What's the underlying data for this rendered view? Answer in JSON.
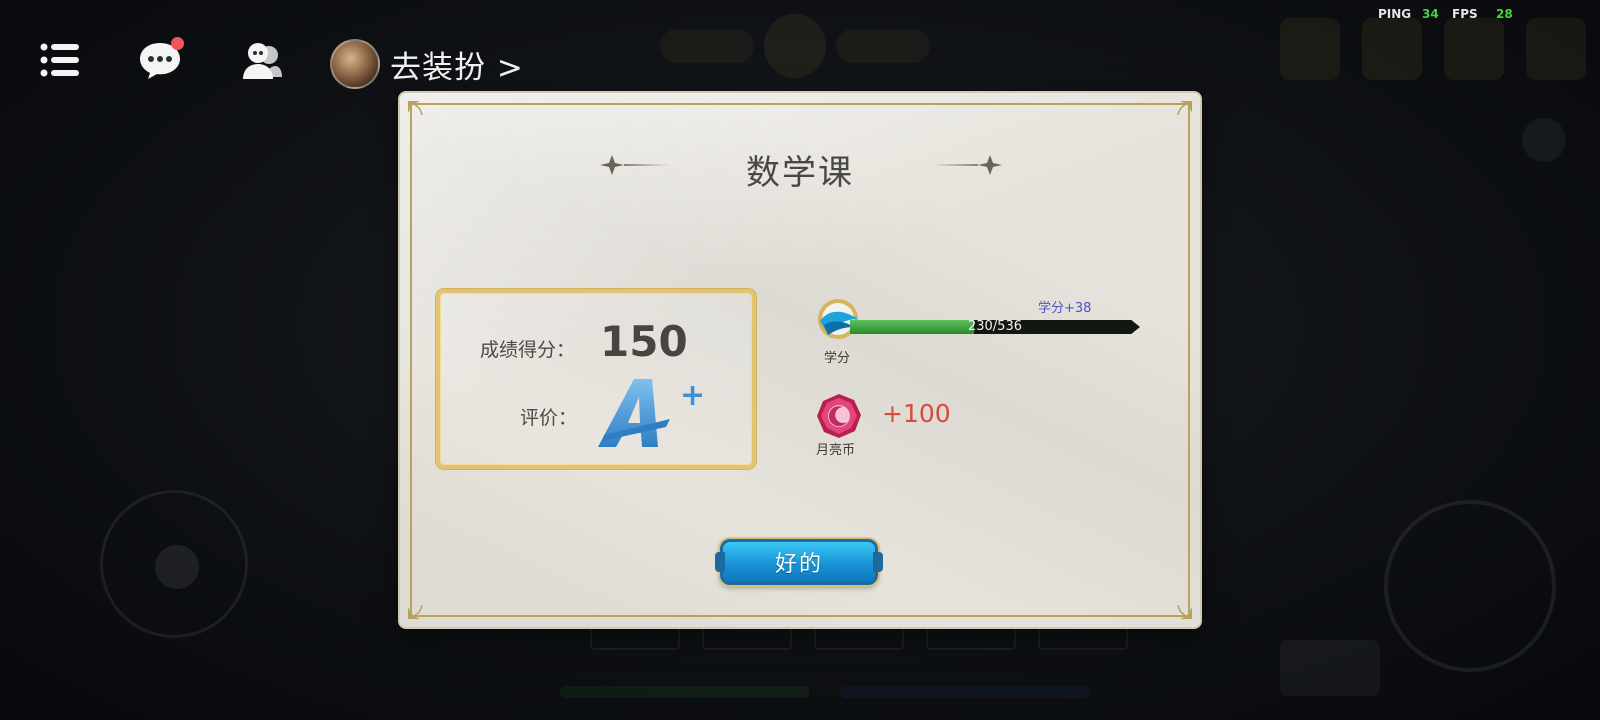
{
  "hud": {
    "dress_up_label": "去装扮 >",
    "chat_has_notification": true
  },
  "stats": {
    "ping_label": "PING",
    "ping_value": "34",
    "fps_label": "FPS",
    "fps_value": "28"
  },
  "dialog": {
    "title": "数学课",
    "score_label": "成绩得分：",
    "score_value": "150",
    "grade_label": "评价：",
    "grade_value": "A+",
    "credit": {
      "name": "学分",
      "bonus": "学分+38",
      "current": 230,
      "max": 536,
      "text": "230/536"
    },
    "coin": {
      "name": "月亮币",
      "amount": "+100"
    },
    "ok_label": "好的"
  },
  "colors": {
    "accent_gold": "#e2c370",
    "button_blue": "#1993d6",
    "progress_green": "#3aa83a",
    "ping_value_green": "#3fd63f",
    "coin_amount_red": "#d84a3a",
    "bonus_text_blue": "#5050c8"
  },
  "icons": {
    "menu": "menu-list-icon",
    "chat": "chat-bubble-icon",
    "friends": "friends-icon",
    "credit": "credit-wing-icon",
    "coin": "moon-coin-icon",
    "grade": "grade-a-plus-icon"
  }
}
